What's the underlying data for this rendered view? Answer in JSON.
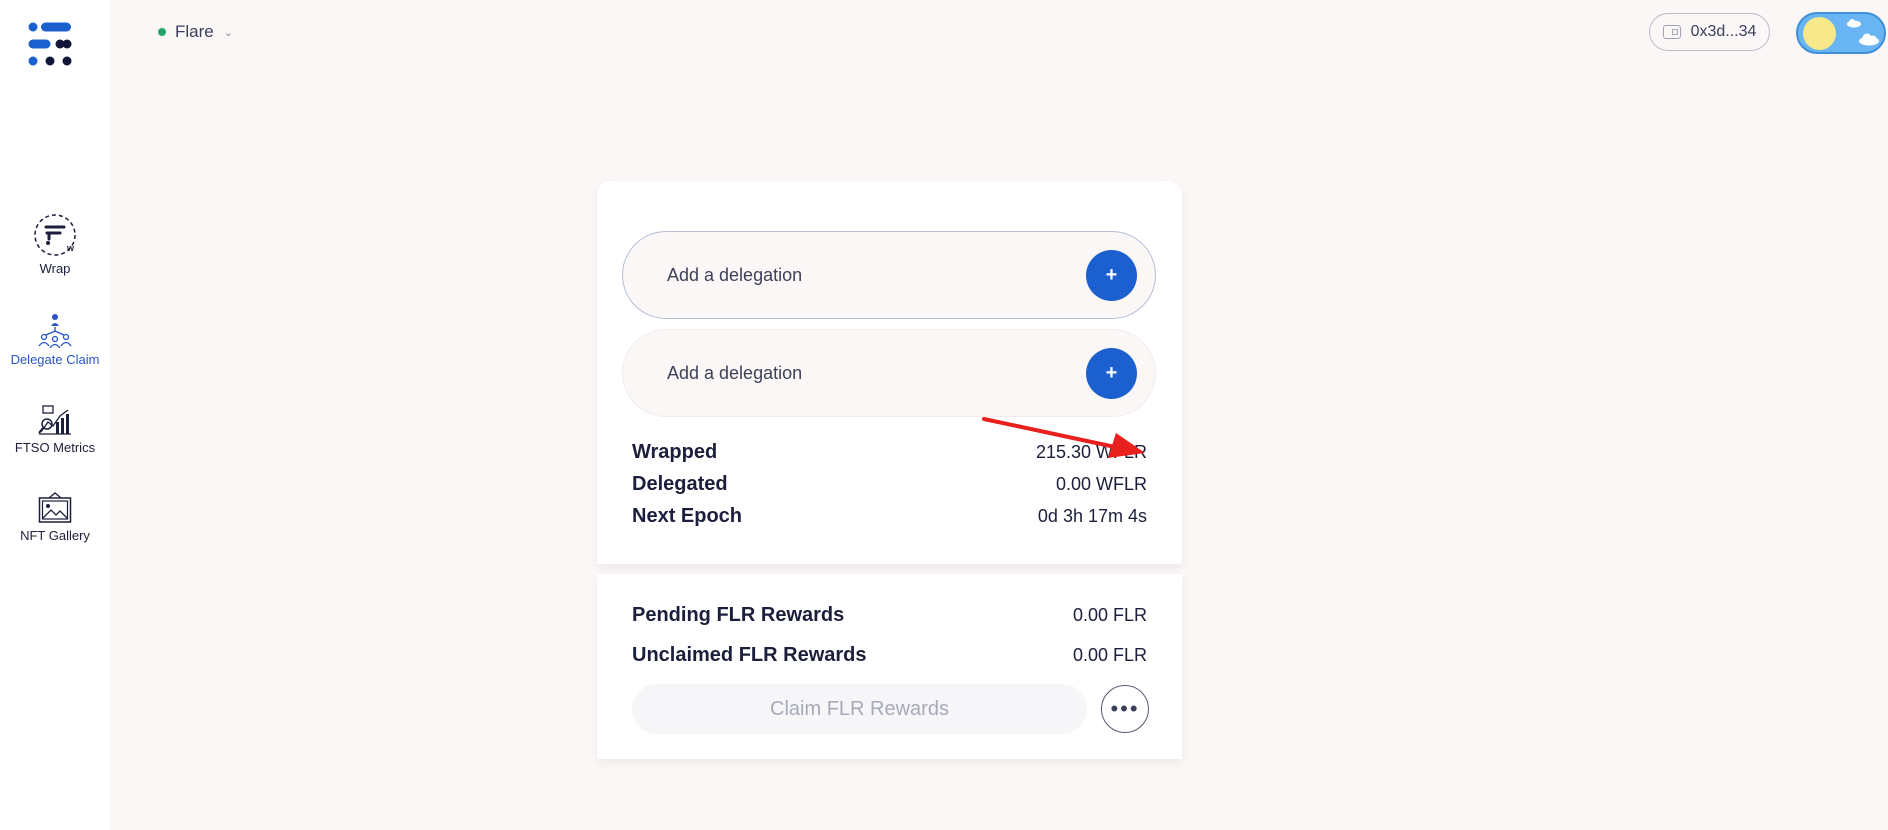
{
  "sidebar": {
    "items": [
      {
        "label": "Wrap",
        "icon": "wrap-icon"
      },
      {
        "label": "Delegate Claim",
        "icon": "delegate-icon",
        "active": true
      },
      {
        "label": "FTSO Metrics",
        "icon": "metrics-icon"
      },
      {
        "label": "NFT Gallery",
        "icon": "gallery-icon"
      }
    ]
  },
  "header": {
    "network": "Flare",
    "wallet": "0x3d...34"
  },
  "delegations": [
    {
      "label": "Add a delegation",
      "button": "+"
    },
    {
      "label": "Add a delegation",
      "button": "+"
    }
  ],
  "stats": {
    "wrapped": {
      "label": "Wrapped",
      "value": "215.30 WFLR"
    },
    "delegated": {
      "label": "Delegated",
      "value": "0.00 WFLR"
    },
    "epoch": {
      "label": "Next Epoch",
      "value": "0d 3h 17m 4s"
    }
  },
  "rewards": {
    "pending": {
      "label": "Pending FLR Rewards",
      "value": "0.00 FLR"
    },
    "unclaimed": {
      "label": "Unclaimed FLR Rewards",
      "value": "0.00 FLR"
    },
    "claim_button": "Claim FLR Rewards",
    "more_button": "•••"
  },
  "colors": {
    "accent": "#1c5fcf",
    "background": "#fbf7f6",
    "annotation_arrow": "#e8201e"
  }
}
